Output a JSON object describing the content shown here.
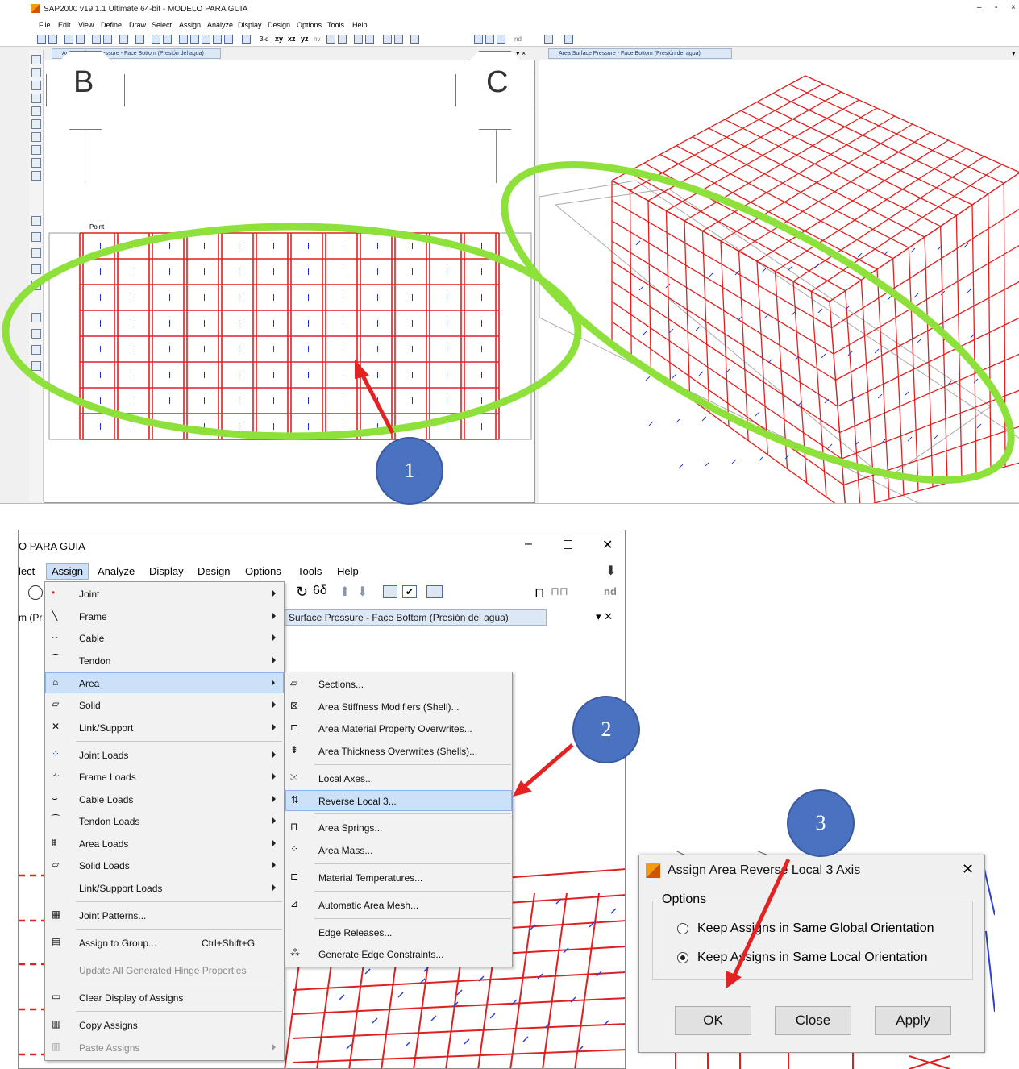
{
  "top_window": {
    "title": "SAP2000 v19.1.1 Ultimate 64-bit - MODELO PARA GUIA",
    "menus": [
      "File",
      "Edit",
      "View",
      "Define",
      "Draw",
      "Select",
      "Assign",
      "Analyze",
      "Display",
      "Design",
      "Options",
      "Tools",
      "Help"
    ],
    "toolbar_text": [
      "3-d",
      "xy",
      "xz",
      "yz",
      "nv",
      "nd"
    ],
    "left_tab": "Area Surface Pressure - Face Bottom (Presión del agua)",
    "right_tab": "Area Surface Pressure - Face Bottom (Presión del agua)",
    "grid_labels": [
      "B",
      "C"
    ],
    "point_label": "Point"
  },
  "bottom_window": {
    "title": "O PARA GUIA",
    "menus": [
      "lect",
      "Assign",
      "Analyze",
      "Display",
      "Design",
      "Options",
      "Tools",
      "Help"
    ],
    "tab_left": "m (Pr",
    "tab_right": "Surface Pressure - Face Bottom (Presión del agua)",
    "toolbar_text": "nd",
    "assign_menu": [
      {
        "label": "Joint",
        "submenu": true
      },
      {
        "label": "Frame",
        "submenu": true
      },
      {
        "label": "Cable",
        "submenu": true
      },
      {
        "label": "Tendon",
        "submenu": true
      },
      {
        "label": "Area",
        "submenu": true,
        "selected": true
      },
      {
        "label": "Solid",
        "submenu": true
      },
      {
        "label": "Link/Support",
        "submenu": true
      },
      {
        "label": "Joint Loads",
        "submenu": true
      },
      {
        "label": "Frame Loads",
        "submenu": true
      },
      {
        "label": "Cable Loads",
        "submenu": true
      },
      {
        "label": "Tendon Loads",
        "submenu": true
      },
      {
        "label": "Area Loads",
        "submenu": true
      },
      {
        "label": "Solid Loads",
        "submenu": true
      },
      {
        "label": "Link/Support Loads",
        "submenu": true
      },
      {
        "label": "Joint Patterns...",
        "submenu": false
      },
      {
        "label": "Assign to Group...",
        "shortcut": "Ctrl+Shift+G",
        "submenu": false
      },
      {
        "label": "Update All Generated Hinge Properties",
        "submenu": false,
        "disabled": true
      },
      {
        "label": "Clear Display of Assigns",
        "submenu": false
      },
      {
        "label": "Copy Assigns",
        "submenu": false
      },
      {
        "label": "Paste Assigns",
        "submenu": true,
        "disabled": true
      }
    ],
    "area_submenu": [
      "Sections...",
      "Area Stiffness Modifiers (Shell)...",
      "Area Material Property Overwrites...",
      "Area Thickness Overwrites (Shells)...",
      "Local Axes...",
      "Reverse Local 3...",
      "Area Springs...",
      "Area Mass...",
      "Material Temperatures...",
      "Automatic Area Mesh...",
      "Edge Releases...",
      "Generate Edge Constraints..."
    ],
    "area_submenu_selected": "Reverse Local 3..."
  },
  "dialog": {
    "title": "Assign Area Reverse Local 3 Axis",
    "group_label": "Options",
    "options": [
      "Keep Assigns in Same Global Orientation",
      "Keep Assigns in Same Local Orientation"
    ],
    "selected_option": "Keep Assigns in Same Local Orientation",
    "buttons": [
      "OK",
      "Close",
      "Apply"
    ]
  },
  "markers": [
    "1",
    "2",
    "3"
  ],
  "colors": {
    "highlight_ellipse": "#8ee03a",
    "arrow": "#e52222",
    "marker": "#4a72c0",
    "grid": "#e02020",
    "menu_selected": "#cce0f7"
  }
}
